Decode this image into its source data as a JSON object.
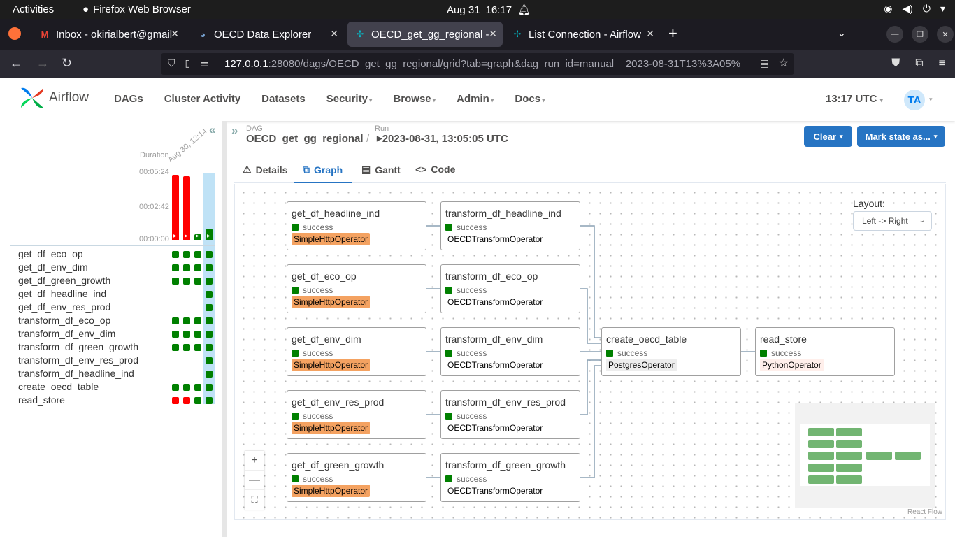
{
  "topbar": {
    "activities": "Activities",
    "app_name": "Firefox Web Browser",
    "date": "Aug 31",
    "time": "16:17"
  },
  "browser": {
    "tabs": [
      {
        "label": "Inbox - okirialbert@gmail",
        "icon": "gmail-icon"
      },
      {
        "label": "OECD Data Explorer",
        "icon": "oecd-icon"
      },
      {
        "label": "OECD_get_gg_regional -",
        "icon": "airflow-icon",
        "active": true
      },
      {
        "label": "List Connection - Airflow",
        "icon": "airflow-icon"
      }
    ],
    "url_host": "127.0.0.1",
    "url_path": ":28080/dags/OECD_get_gg_regional/grid?tab=graph&dag_run_id=manual__2023-08-31T13%3A05%"
  },
  "header": {
    "brand": "Airflow",
    "menu": [
      "DAGs",
      "Cluster Activity",
      "Datasets",
      "Security",
      "Browse",
      "Admin",
      "Docs"
    ],
    "utc": "13:17 UTC",
    "avatar": "TA"
  },
  "grid": {
    "duration_label": "Duration",
    "duration_ticks": [
      "00:05:24",
      "00:02:42",
      "00:00:00"
    ],
    "run_date": "Aug 30, 12:14",
    "runs": [
      {
        "duration_fraction": 0.95,
        "state": "failed"
      },
      {
        "duration_fraction": 0.93,
        "state": "failed"
      },
      {
        "duration_fraction": 0.08,
        "state": "success"
      },
      {
        "duration_fraction": 0.16,
        "state": "success"
      }
    ],
    "tasks": [
      {
        "name": "get_df_eco_op",
        "states": [
          "success",
          "success",
          "success",
          "success"
        ]
      },
      {
        "name": "get_df_env_dim",
        "states": [
          "success",
          "success",
          "success",
          "success"
        ]
      },
      {
        "name": "get_df_green_growth",
        "states": [
          "success",
          "success",
          "success",
          "success"
        ]
      },
      {
        "name": "get_df_headline_ind",
        "states": [
          "",
          "",
          "",
          "success"
        ]
      },
      {
        "name": "get_df_env_res_prod",
        "states": [
          "",
          "",
          "",
          "success"
        ]
      },
      {
        "name": "transform_df_eco_op",
        "states": [
          "success",
          "success",
          "success",
          "success"
        ]
      },
      {
        "name": "transform_df_env_dim",
        "states": [
          "success",
          "success",
          "success",
          "success"
        ]
      },
      {
        "name": "transform_df_green_growth",
        "states": [
          "success",
          "success",
          "success",
          "success"
        ]
      },
      {
        "name": "transform_df_env_res_prod",
        "states": [
          "",
          "",
          "",
          "success"
        ]
      },
      {
        "name": "transform_df_headline_ind",
        "states": [
          "",
          "",
          "",
          "success"
        ]
      },
      {
        "name": "create_oecd_table",
        "states": [
          "success",
          "success",
          "success",
          "success"
        ]
      },
      {
        "name": "read_store",
        "states": [
          "failed",
          "failed",
          "success",
          "success"
        ]
      }
    ],
    "colors": {
      "success": "#008000",
      "failed": "#ff0000"
    }
  },
  "breadcrumb": {
    "dag_label": "DAG",
    "dag": "OECD_get_gg_regional",
    "sep": "/",
    "run_label": "Run",
    "run": "2023-08-31, 13:05:05 UTC"
  },
  "actions": {
    "clear": "Clear",
    "mark_state": "Mark state as..."
  },
  "tabs": [
    "Details",
    "Graph",
    "Gantt",
    "Code"
  ],
  "graph": {
    "layout_label": "Layout:",
    "layout_value": "Left -> Right",
    "attribution": "React Flow",
    "nodes": [
      {
        "name": "get_df_headline_ind",
        "state": "success",
        "operator": "SimpleHttpOperator"
      },
      {
        "name": "get_df_eco_op",
        "state": "success",
        "operator": "SimpleHttpOperator"
      },
      {
        "name": "get_df_env_dim",
        "state": "success",
        "operator": "SimpleHttpOperator"
      },
      {
        "name": "get_df_env_res_prod",
        "state": "success",
        "operator": "SimpleHttpOperator"
      },
      {
        "name": "get_df_green_growth",
        "state": "success",
        "operator": "SimpleHttpOperator"
      },
      {
        "name": "transform_df_headline_ind",
        "state": "success",
        "operator": "OECDTransformOperator"
      },
      {
        "name": "transform_df_eco_op",
        "state": "success",
        "operator": "OECDTransformOperator"
      },
      {
        "name": "transform_df_env_dim",
        "state": "success",
        "operator": "OECDTransformOperator"
      },
      {
        "name": "transform_df_env_res_prod",
        "state": "success",
        "operator": "OECDTransformOperator"
      },
      {
        "name": "transform_df_green_growth",
        "state": "success",
        "operator": "OECDTransformOperator"
      },
      {
        "name": "create_oecd_table",
        "state": "success",
        "operator": "PostgresOperator"
      },
      {
        "name": "read_store",
        "state": "success",
        "operator": "PythonOperator"
      }
    ],
    "operator_colors": {
      "SimpleHttpOperator": "#f4a261",
      "OECDTransformOperator": "#ffffff",
      "PostgresOperator": "#ededed",
      "PythonOperator": "#ffefeb"
    }
  }
}
